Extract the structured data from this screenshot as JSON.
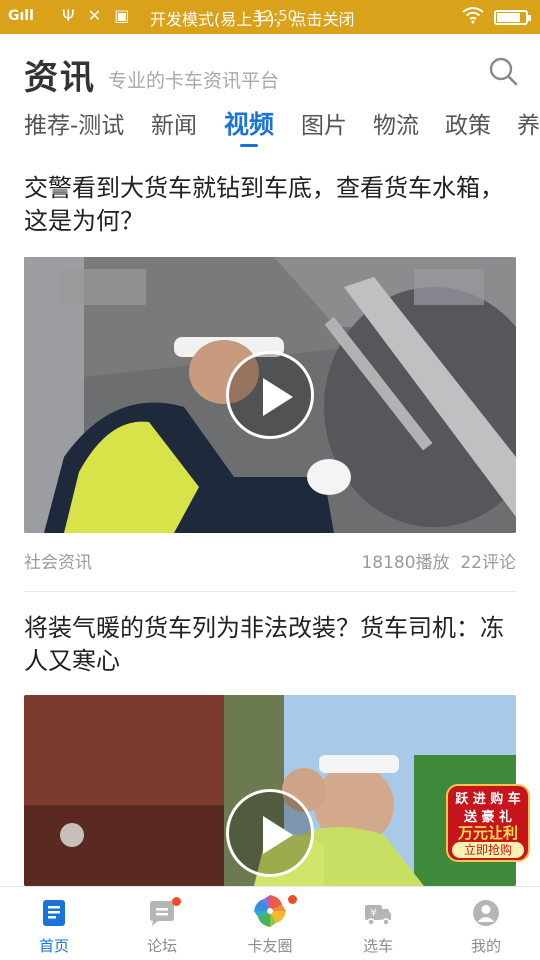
{
  "status_bar": {
    "signal": "Gıll",
    "usb_icon": "usb-icon",
    "tools_icon": "tools-icon",
    "notification_icon": "notification-icon",
    "notice": "开发模式(易上手)，点击关闭",
    "time": "12:50",
    "battery_level": 0.82,
    "background_color": "#d9a21a"
  },
  "header": {
    "logo": "资讯",
    "slogan": "专业的卡车资讯平台",
    "search_icon": "search-icon"
  },
  "tabs": [
    {
      "label": "推荐-测试"
    },
    {
      "label": "新闻"
    },
    {
      "label": "视频",
      "active": true
    },
    {
      "label": "图片"
    },
    {
      "label": "物流"
    },
    {
      "label": "政策"
    },
    {
      "label": "养"
    }
  ],
  "articles": [
    {
      "title": "交警看到大货车就钻到车底，查看货车水箱，这是为何？",
      "source": "社会资讯",
      "plays": "18180播放",
      "comments": "22评论"
    },
    {
      "title": "将装气暖的货车列为非法改装？货车司机：冻人又寒心",
      "promo": {
        "line1": "跃 进 购 车",
        "line2": "送 豪 礼",
        "line3": "万元让利",
        "line4": "立即抢购"
      }
    }
  ],
  "bottom_nav": [
    {
      "label": "首页",
      "icon": "news-home-icon",
      "active": true
    },
    {
      "label": "论坛",
      "icon": "forum-icon",
      "badge": true
    },
    {
      "label": "卡友圈",
      "icon": "pinwheel-icon",
      "badge": true
    },
    {
      "label": "选车",
      "icon": "truck-select-icon"
    },
    {
      "label": "我的",
      "icon": "profile-icon"
    }
  ],
  "colors": {
    "accent": "#1a73d9",
    "status_bar": "#d9a21a",
    "badge": "#f04a2a",
    "promo_red": "#c8141c"
  }
}
